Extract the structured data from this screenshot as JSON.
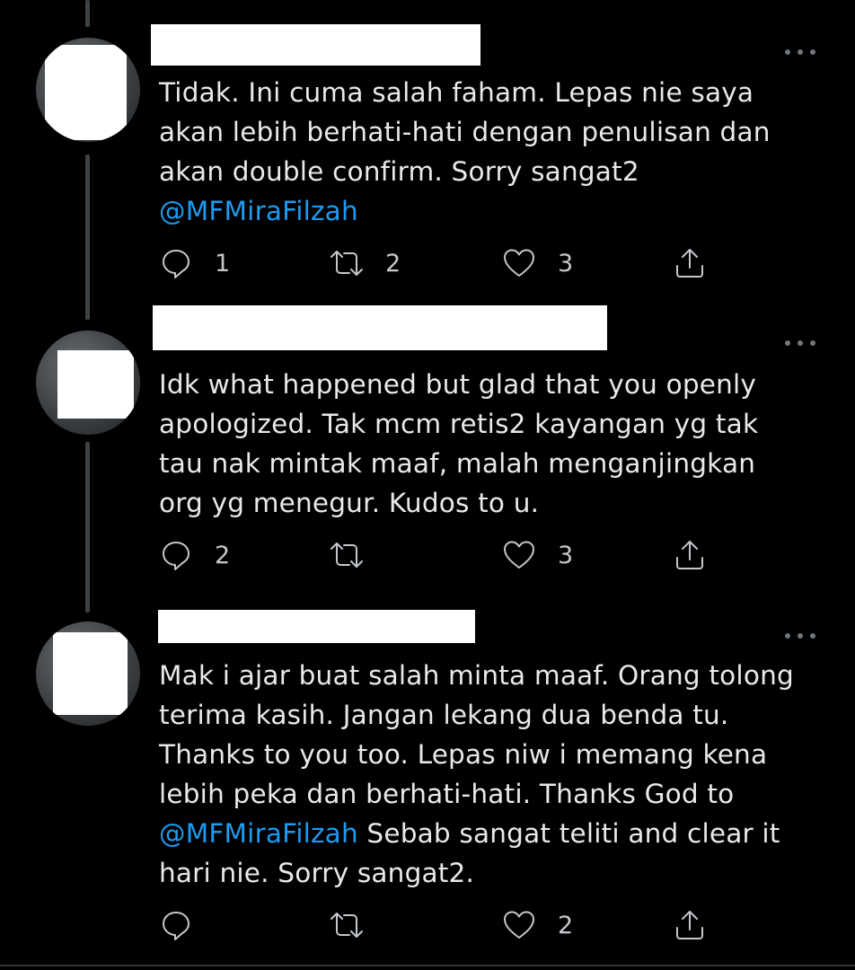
{
  "tweets": [
    {
      "id": "t1",
      "text_parts": [
        {
          "text": "Tidak. Ini cuma salah faham. Lepas nie saya\nakan lebih berhati-hati dengan penulisan dan\nakan double confirm. Sorry sangat2\n",
          "mention": false
        },
        {
          "text": "@MFMiraFilzah",
          "mention": true
        }
      ],
      "replies": "1",
      "retweets": "2",
      "likes": "3"
    },
    {
      "id": "t2",
      "text_parts": [
        {
          "text": "Idk what happened but glad that you openly\napologized. Tak mcm retis2 kayangan yg tak\ntau nak mintak maaf, malah menganjingkan\norg yg menegur. Kudos to u.",
          "mention": false
        }
      ],
      "replies": "2",
      "retweets": "",
      "likes": "3"
    },
    {
      "id": "t3",
      "text_parts": [
        {
          "text": "Mak i ajar buat salah minta maaf. Orang tolong\nterima kasih. Jangan lekang dua benda tu.\nThanks to you too. Lepas niw i memang kena\nlebih peka dan berhati-hati. Thanks God to\n",
          "mention": false
        },
        {
          "text": "@MFMiraFilzah",
          "mention": true
        },
        {
          "text": " Sebab sangat teliti and clear it\nhari nie. Sorry sangat2.",
          "mention": false
        }
      ],
      "replies": "",
      "retweets": "",
      "likes": "2"
    }
  ],
  "icons": {
    "reply": "reply-icon",
    "retweet": "retweet-icon",
    "like": "like-icon",
    "share": "share-icon",
    "more": "more-icon"
  },
  "colors": {
    "background": "#000000",
    "text": "#e7e9ea",
    "mention": "#1d9bf0",
    "icon": "#c4c8cc"
  }
}
